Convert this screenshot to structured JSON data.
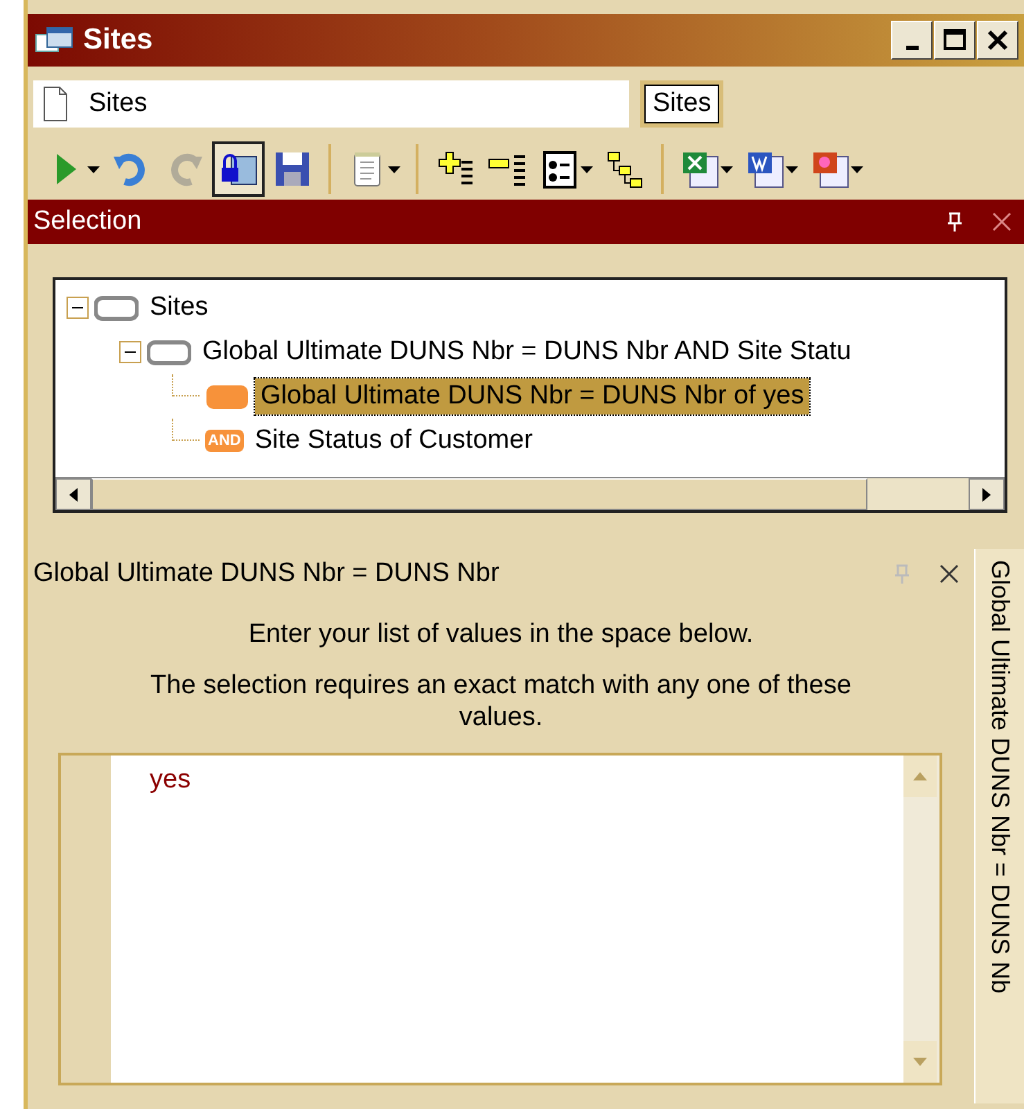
{
  "window": {
    "title": "Sites"
  },
  "name_field": {
    "value": "Sites"
  },
  "name_badge": "Sites",
  "toolbar_groups": [
    [
      {
        "dropdown": true,
        "disabled": false,
        "pressed": false
      },
      {
        "dropdown": false,
        "disabled": false,
        "pressed": false
      },
      {
        "dropdown": false,
        "disabled": true,
        "pressed": false
      },
      {
        "dropdown": false,
        "disabled": false,
        "pressed": true
      },
      {
        "dropdown": false,
        "disabled": false,
        "pressed": false
      }
    ],
    [
      {
        "dropdown": true,
        "disabled": false,
        "pressed": false
      }
    ],
    [
      {
        "dropdown": false,
        "disabled": false,
        "pressed": false
      },
      {
        "dropdown": false,
        "disabled": false,
        "pressed": false
      },
      {
        "dropdown": true,
        "disabled": false,
        "pressed": false
      },
      {
        "dropdown": false,
        "disabled": false,
        "pressed": false
      }
    ],
    [
      {
        "dropdown": true,
        "disabled": false,
        "pressed": false
      },
      {
        "dropdown": true,
        "disabled": false,
        "pressed": false
      },
      {
        "dropdown": true,
        "disabled": false,
        "pressed": false
      }
    ]
  ],
  "selection_panel": {
    "title": "Selection"
  },
  "tree": [
    {
      "label": "Sites",
      "kind": "group",
      "expanded": true,
      "selected": false,
      "children": [
        {
          "label": "Global Ultimate DUNS Nbr = DUNS Nbr AND Site Statu",
          "kind": "group",
          "expanded": true,
          "selected": false,
          "children": [
            {
              "label": "Global Ultimate DUNS Nbr = DUNS Nbr of yes",
              "kind": "criterion",
              "selected": true
            },
            {
              "label": "Site Status of Customer",
              "kind": "and",
              "badge": "AND",
              "selected": false
            }
          ]
        }
      ]
    }
  ],
  "detail_panel": {
    "title": "Global Ultimate DUNS Nbr = DUNS Nbr",
    "instructions": [
      "Enter your list of values in the space below.",
      "The selection requires an exact match with any one of these values."
    ],
    "values": [
      "yes"
    ]
  },
  "side_tab": "Global Ultimate DUNS Nbr = DUNS Nb"
}
